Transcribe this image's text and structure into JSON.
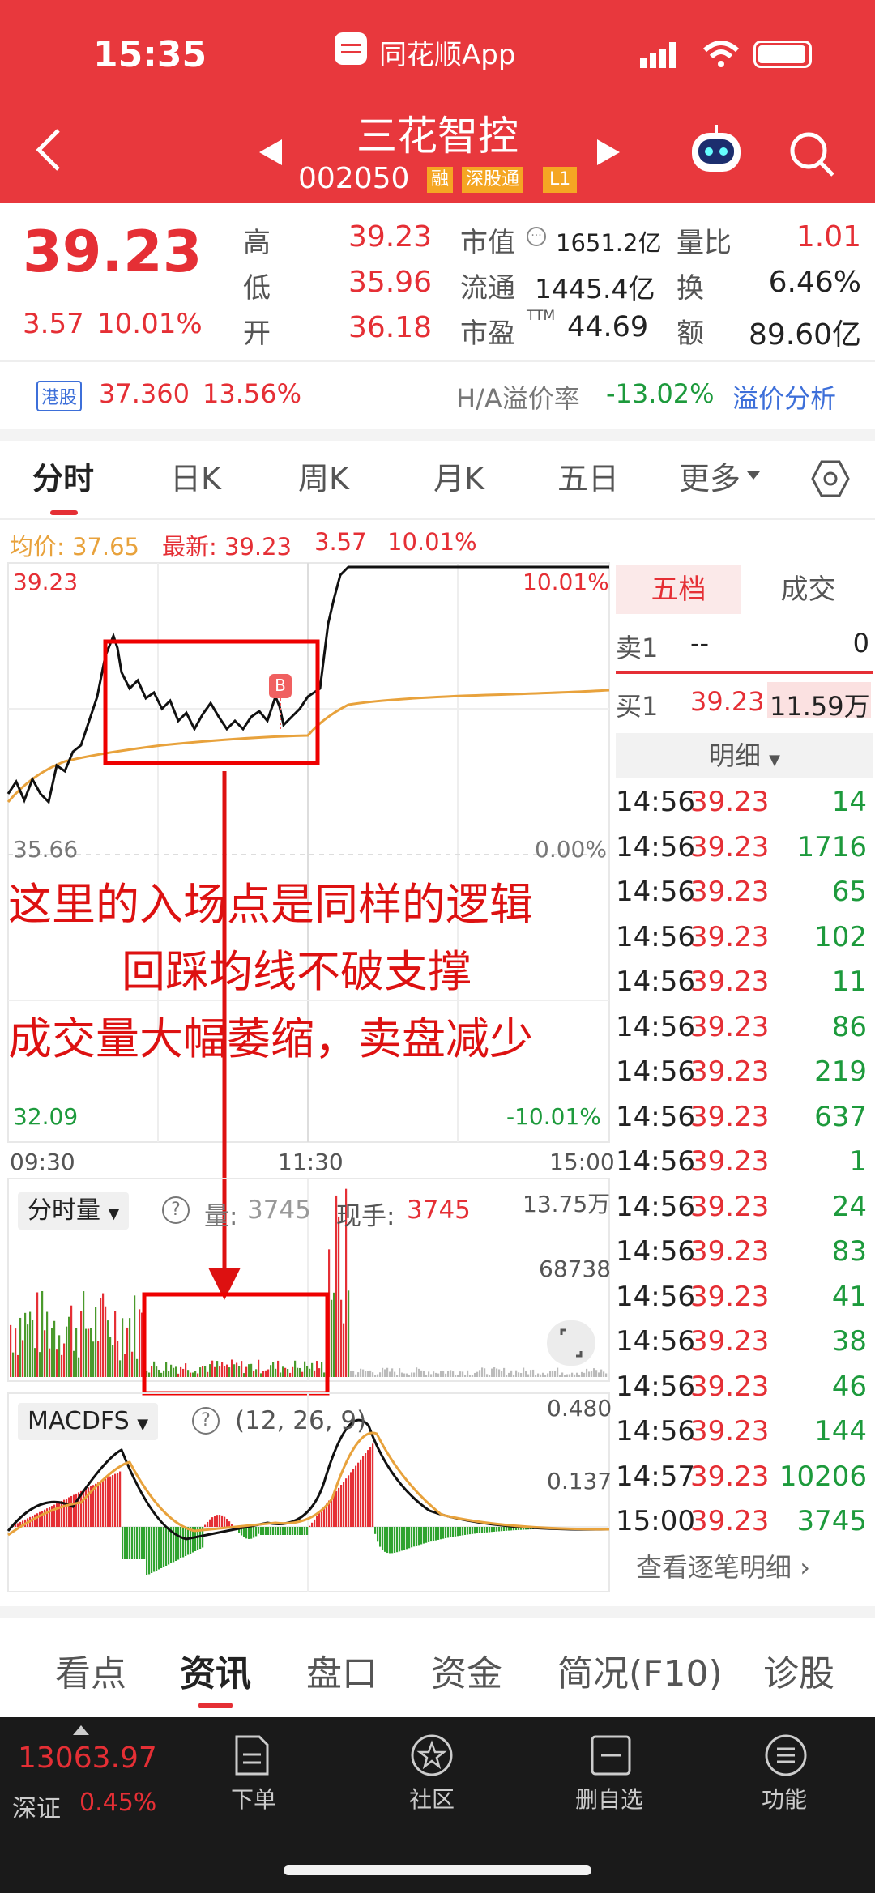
{
  "status_bar": {
    "time": "15:35",
    "app_label": "同花顺App"
  },
  "header": {
    "stock_name": "三花智控",
    "stock_code": "002050",
    "badges": [
      "融",
      "深股通",
      "L1"
    ]
  },
  "quote": {
    "price": "39.23",
    "change": "3.57",
    "change_pct": "10.01%",
    "high_label": "高",
    "high": "39.23",
    "low_label": "低",
    "low": "35.96",
    "open_label": "开",
    "open": "36.18",
    "mcap_label": "市值",
    "mcap": "1651.2亿",
    "float_label": "流通",
    "float": "1445.4亿",
    "pe_label": "市盈",
    "pe_sup": "TTM",
    "pe": "44.69",
    "vol_ratio_label": "量比",
    "vol_ratio": "1.01",
    "turnover_label": "换",
    "turnover": "6.46%",
    "amount_label": "额",
    "amount": "89.60亿"
  },
  "hk": {
    "badge": "港股",
    "price": "37.360",
    "pct": "13.56%",
    "premium_label": "H/A溢价率",
    "premium": "-13.02%",
    "analysis": "溢价分析"
  },
  "chart_tabs": [
    "分时",
    "日K",
    "周K",
    "月K",
    "五日",
    "更多"
  ],
  "chart_info": {
    "avg": "均价: 37.65",
    "latest": "最新: 39.23",
    "chg": "3.57",
    "pct": "10.01%"
  },
  "axis": {
    "top_price": "39.23",
    "top_pct": "10.01%",
    "mid_price": "35.66",
    "mid_pct": "0.00%",
    "bottom_price": "32.09",
    "bottom_pct": "-10.01%",
    "t_start": "09:30",
    "t_mid": "11:30",
    "t_end": "15:00"
  },
  "buy_marker": "B",
  "annotation": [
    "这里的入场点是同样的逻辑",
    "回踩均线不破支撑",
    "成交量大幅萎缩，卖盘减少"
  ],
  "volume": {
    "selector": "分时量",
    "help": "?",
    "qty_label": "量:",
    "qty": "3745",
    "now_label": "现手:",
    "now": "3745",
    "max": "13.75万",
    "mid": "68738"
  },
  "macd": {
    "selector": "MACDFS",
    "help": "?",
    "params": "(12, 26, 9)",
    "top": "0.480",
    "mid": "0.137"
  },
  "order_book": {
    "tab_five": "五档",
    "tab_trade": "成交",
    "sell1_label": "卖1",
    "sell1_price": "--",
    "sell1_vol": "0",
    "buy1_label": "买1",
    "buy1_price": "39.23",
    "buy1_vol": "11.59万",
    "detail_label": "明细",
    "trades": [
      {
        "t": "14:56",
        "p": "39.23",
        "v": "14"
      },
      {
        "t": "14:56",
        "p": "39.23",
        "v": "1716"
      },
      {
        "t": "14:56",
        "p": "39.23",
        "v": "65"
      },
      {
        "t": "14:56",
        "p": "39.23",
        "v": "102"
      },
      {
        "t": "14:56",
        "p": "39.23",
        "v": "11"
      },
      {
        "t": "14:56",
        "p": "39.23",
        "v": "86"
      },
      {
        "t": "14:56",
        "p": "39.23",
        "v": "219"
      },
      {
        "t": "14:56",
        "p": "39.23",
        "v": "637"
      },
      {
        "t": "14:56",
        "p": "39.23",
        "v": "1"
      },
      {
        "t": "14:56",
        "p": "39.23",
        "v": "24"
      },
      {
        "t": "14:56",
        "p": "39.23",
        "v": "83"
      },
      {
        "t": "14:56",
        "p": "39.23",
        "v": "41"
      },
      {
        "t": "14:56",
        "p": "39.23",
        "v": "38"
      },
      {
        "t": "14:56",
        "p": "39.23",
        "v": "46"
      },
      {
        "t": "14:56",
        "p": "39.23",
        "v": "144"
      },
      {
        "t": "14:57",
        "p": "39.23",
        "v": "10206"
      },
      {
        "t": "15:00",
        "p": "39.23",
        "v": "3745"
      }
    ],
    "more": "查看逐笔明细"
  },
  "bottom_tabs": [
    "看点",
    "资讯",
    "盘口",
    "资金",
    "简况(F10)",
    "诊股"
  ],
  "nav": {
    "index_value": "13063.97",
    "index_name": "深证",
    "index_pct": "0.45%",
    "items": [
      "下单",
      "社区",
      "删自选",
      "功能"
    ]
  },
  "colors": {
    "brand": "#e8383d",
    "up": "#e52f35",
    "down": "#1d9a3c",
    "avg_line": "#e8a23c"
  }
}
